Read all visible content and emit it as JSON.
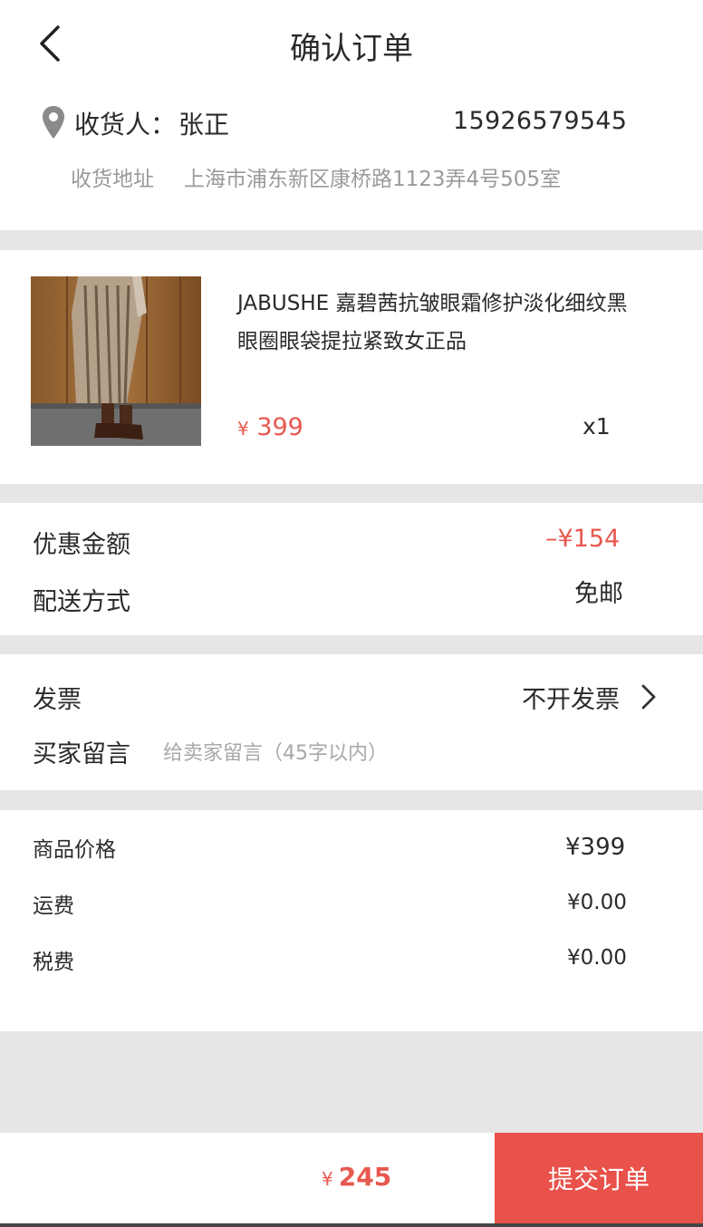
{
  "header": {
    "title": "确认订单",
    "receiver_label": "收货人：",
    "receiver_name": "张正",
    "phone": "15926579545",
    "address_label": "收货地址",
    "address": "上海市浦东新区康桥路1123弄4号505室"
  },
  "product": {
    "name": "JABUSHE 嘉碧茜抗皱眼霜修护淡化细纹黑眼圈眼袋提拉紧致女正品",
    "currency": "¥",
    "price": "399",
    "quantity": "x1"
  },
  "discount": {
    "label": "优惠金额",
    "value": "–¥154",
    "shipping_label": "配送方式",
    "shipping_value": "免邮"
  },
  "invoice": {
    "label": "发票",
    "value": "不开发票",
    "message_label": "买家留言",
    "message_placeholder": "给卖家留言（45字以内）"
  },
  "summary": {
    "rows": [
      {
        "label": "商品价格",
        "value": "¥399"
      },
      {
        "label": "运费",
        "value": "¥0.00"
      },
      {
        "label": "税费",
        "value": "¥0.00"
      }
    ]
  },
  "bottom": {
    "currency": "¥",
    "total": "245",
    "submit_label": "提交订单"
  },
  "colors": {
    "accent": "#e8524a",
    "background": "#e6e6e6"
  },
  "icons": {
    "back": "chevron-left-icon",
    "location": "location-pin-icon",
    "more": "chevron-right-icon"
  }
}
